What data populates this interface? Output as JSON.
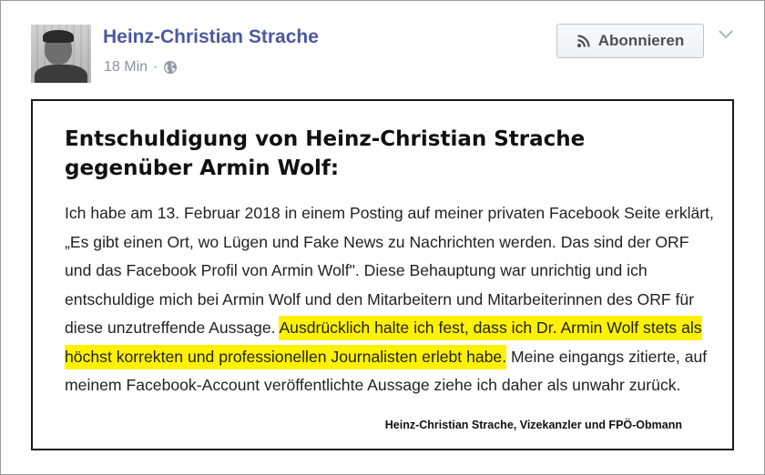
{
  "post": {
    "author_name": "Heinz-Christian Strache",
    "timestamp": "18 Min",
    "separator": "·",
    "audience_icon": "globe-icon",
    "subscribe_label": "Abonnieren",
    "subscribe_icon": "rss-icon",
    "menu_icon": "chevron-down-icon",
    "colors": {
      "author_link": "#4b5a9e",
      "meta_text": "#8d949e",
      "highlight": "#fff200"
    }
  },
  "statement": {
    "title_line1": "Entschuldigung von Heinz-Christian Strache",
    "title_line2": "gegenüber Armin Wolf:",
    "body_line1": "Ich habe am 13. Februar 2018 in einem Posting auf meiner privaten Facebook Seite erklärt,",
    "body_line2": "„Es gibt einen Ort, wo Lügen und Fake News zu Nachrichten werden. Das sind der ORF",
    "body_line3": "und das Facebook Profil von Armin Wolf\". Diese Behauptung war unrichtig und ich",
    "body_line4": "entschuldige mich bei Armin Wolf und den Mitarbeitern und Mitarbeiterinnen des ORF für",
    "body_line5_plain": "diese unzutreffende Aussage.",
    "body_line5_highlight": "Ausdrücklich halte ich fest, dass ich Dr. Armin Wolf stets als",
    "body_line6_highlight": "höchst korrekten und professionellen Journalisten erlebt habe.",
    "body_line6_plain": "Meine eingangs zitierte, auf",
    "body_line7": "meinem Facebook-Account veröffentlichte Aussage ziehe ich daher als unwahr zurück.",
    "signature": "Heinz-Christian Strache, Vizekanzler und FPÖ-Obmann"
  }
}
